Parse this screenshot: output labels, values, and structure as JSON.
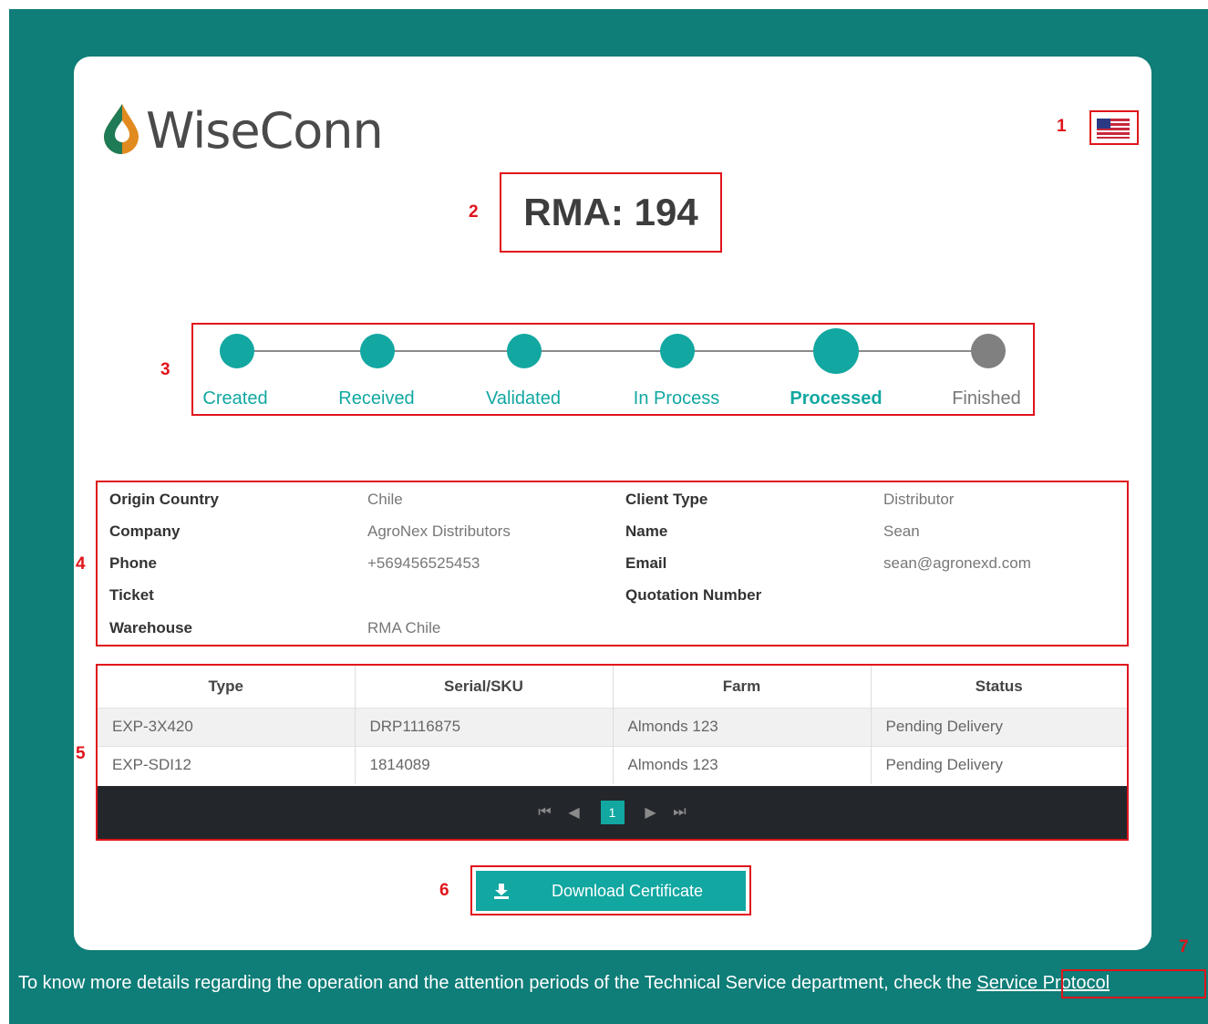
{
  "app": {
    "logo_text": "WiseConn",
    "logo_icon": "water-drop-icon",
    "language_icon": "us-flag-icon"
  },
  "rma": {
    "title": "RMA: 194"
  },
  "stepper": {
    "steps": [
      {
        "label": "Created",
        "state": "done"
      },
      {
        "label": "Received",
        "state": "done"
      },
      {
        "label": "Validated",
        "state": "done"
      },
      {
        "label": "In Process",
        "state": "done"
      },
      {
        "label": "Processed",
        "state": "current"
      },
      {
        "label": "Finished",
        "state": "pending"
      }
    ]
  },
  "info": {
    "origin_country": {
      "label": "Origin Country",
      "value": "Chile"
    },
    "company": {
      "label": "Company",
      "value": "AgroNex Distributors"
    },
    "phone": {
      "label": "Phone",
      "value": "+569456525453"
    },
    "ticket": {
      "label": "Ticket",
      "value": ""
    },
    "warehouse": {
      "label": "Warehouse",
      "value": "RMA Chile"
    },
    "client_type": {
      "label": "Client Type",
      "value": "Distributor"
    },
    "name": {
      "label": "Name",
      "value": "Sean"
    },
    "email": {
      "label": "Email",
      "value": "sean@agronexd.com"
    },
    "quotation_number": {
      "label": "Quotation Number",
      "value": ""
    }
  },
  "table": {
    "columns": [
      "Type",
      "Serial/SKU",
      "Farm",
      "Status"
    ],
    "rows": [
      [
        "EXP-3X420",
        "DRP1116875",
        "Almonds 123",
        "Pending Delivery"
      ],
      [
        "EXP-SDI12",
        "1814089",
        "Almonds 123",
        "Pending Delivery"
      ]
    ],
    "pager": {
      "current_page": "1"
    }
  },
  "actions": {
    "download_label": "Download Certificate",
    "download_icon": "download-icon"
  },
  "footer": {
    "text": "To know more details regarding the operation and the attention periods of the Technical Service department, check the",
    "link": "Service Protocol"
  },
  "annotations": [
    "1",
    "2",
    "3",
    "4",
    "5",
    "6",
    "7"
  ],
  "colors": {
    "background": "#0f7d78",
    "accent": "#12a7a1",
    "annotation": "#e0141b",
    "pending": "#808080"
  }
}
